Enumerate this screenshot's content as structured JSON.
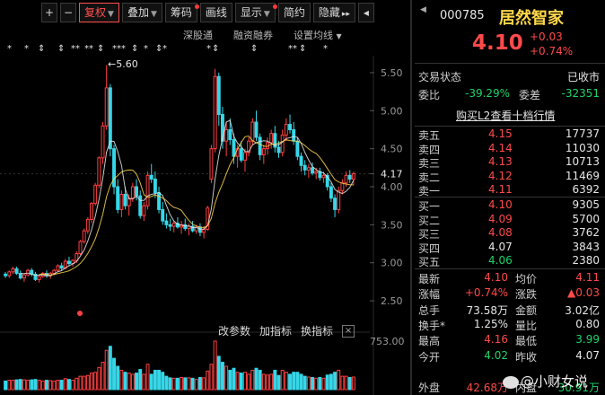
{
  "toolbar": {
    "plus": "+",
    "minus": "−",
    "fuquan": "复权",
    "diejia": "叠加",
    "chouma": "筹码",
    "huaxian": "画线",
    "xianshi": "显示",
    "jianyue": "简约",
    "yincang": "隐藏",
    "forward": "▸▸",
    "back": "◂"
  },
  "subbar": {
    "shenguting": "深股通",
    "rongzi": "融资融券",
    "junxian": "设置均线"
  },
  "markers": [
    "*",
    "*",
    "⇕",
    "⇕",
    "**",
    "**",
    "⇕",
    "***",
    "⇕",
    "*",
    "⇕",
    "*",
    "*",
    "⇕",
    "⇕",
    "**",
    "⇕",
    "*"
  ],
  "chart_data": {
    "type": "candlestick",
    "title": "",
    "y_ticks": [
      "5.50",
      "5.00",
      "4.50",
      "4.17",
      "4.00",
      "3.50",
      "3.00",
      "2.50"
    ],
    "ylim": [
      2.3,
      5.7
    ],
    "current_price": 4.17,
    "high_annotation": "5.60",
    "volume_tick": "753.00",
    "candles": [
      [
        2.85,
        2.88,
        2.8,
        2.83
      ],
      [
        2.83,
        2.9,
        2.8,
        2.88
      ],
      [
        2.88,
        2.95,
        2.85,
        2.92
      ],
      [
        2.92,
        2.95,
        2.84,
        2.86
      ],
      [
        2.86,
        2.9,
        2.78,
        2.8
      ],
      [
        2.8,
        2.86,
        2.75,
        2.84
      ],
      [
        2.84,
        2.92,
        2.82,
        2.9
      ],
      [
        2.9,
        2.93,
        2.82,
        2.85
      ],
      [
        2.85,
        2.88,
        2.76,
        2.78
      ],
      [
        2.78,
        2.84,
        2.74,
        2.82
      ],
      [
        2.82,
        2.88,
        2.8,
        2.86
      ],
      [
        2.86,
        2.9,
        2.8,
        2.83
      ],
      [
        2.83,
        2.88,
        2.79,
        2.86
      ],
      [
        2.86,
        2.92,
        2.84,
        2.9
      ],
      [
        2.9,
        2.98,
        2.88,
        2.96
      ],
      [
        2.96,
        3.0,
        2.9,
        2.93
      ],
      [
        2.93,
        3.05,
        2.91,
        3.02
      ],
      [
        3.02,
        3.08,
        2.96,
        2.99
      ],
      [
        2.99,
        3.05,
        2.95,
        3.03
      ],
      [
        3.03,
        3.15,
        3.0,
        3.12
      ],
      [
        3.12,
        3.3,
        3.1,
        3.28
      ],
      [
        3.28,
        3.45,
        3.25,
        3.42
      ],
      [
        3.42,
        3.6,
        3.38,
        3.57
      ],
      [
        3.57,
        3.8,
        3.52,
        3.78
      ],
      [
        3.78,
        4.05,
        3.75,
        4.02
      ],
      [
        4.02,
        4.4,
        3.98,
        4.38
      ],
      [
        4.38,
        4.85,
        4.3,
        4.8
      ],
      [
        4.8,
        5.6,
        4.75,
        5.3
      ],
      [
        5.3,
        5.35,
        4.4,
        4.5
      ],
      [
        4.5,
        4.55,
        3.9,
        4.0
      ],
      [
        4.0,
        4.1,
        3.65,
        3.7
      ],
      [
        3.7,
        3.95,
        3.6,
        3.9
      ],
      [
        3.9,
        4.0,
        3.7,
        3.75
      ],
      [
        3.75,
        3.9,
        3.62,
        3.85
      ],
      [
        3.85,
        4.05,
        3.8,
        4.0
      ],
      [
        4.0,
        4.1,
        3.82,
        3.88
      ],
      [
        3.88,
        3.95,
        3.58,
        3.62
      ],
      [
        3.62,
        3.8,
        3.55,
        3.75
      ],
      [
        3.75,
        4.2,
        3.7,
        4.15
      ],
      [
        4.15,
        4.3,
        4.05,
        4.1
      ],
      [
        4.1,
        4.2,
        3.85,
        3.92
      ],
      [
        3.92,
        4.0,
        3.65,
        3.7
      ],
      [
        3.7,
        3.8,
        3.5,
        3.55
      ],
      [
        3.55,
        3.65,
        3.45,
        3.5
      ],
      [
        3.5,
        3.58,
        3.42,
        3.48
      ],
      [
        3.48,
        3.55,
        3.4,
        3.52
      ],
      [
        3.52,
        3.6,
        3.45,
        3.47
      ],
      [
        3.47,
        3.55,
        3.38,
        3.5
      ],
      [
        3.5,
        3.58,
        3.42,
        3.45
      ],
      [
        3.45,
        3.52,
        3.36,
        3.48
      ],
      [
        3.48,
        3.55,
        3.4,
        3.42
      ],
      [
        3.42,
        3.5,
        3.38,
        3.47
      ],
      [
        3.47,
        3.52,
        3.35,
        3.4
      ],
      [
        3.4,
        3.48,
        3.32,
        3.44
      ],
      [
        3.44,
        3.75,
        3.42,
        3.72
      ],
      [
        4.1,
        4.55,
        4.05,
        4.5
      ],
      [
        4.5,
        5.55,
        4.45,
        5.45
      ],
      [
        5.45,
        5.5,
        4.8,
        4.95
      ],
      [
        4.95,
        5.05,
        4.5,
        4.6
      ],
      [
        4.6,
        4.85,
        4.4,
        4.75
      ],
      [
        4.75,
        4.9,
        4.55,
        4.62
      ],
      [
        4.62,
        4.7,
        4.3,
        4.4
      ],
      [
        4.4,
        4.55,
        4.25,
        4.5
      ],
      [
        4.5,
        4.6,
        4.32,
        4.35
      ],
      [
        4.35,
        4.5,
        4.2,
        4.45
      ],
      [
        4.45,
        4.65,
        4.4,
        4.6
      ],
      [
        4.6,
        4.9,
        4.55,
        4.85
      ],
      [
        4.85,
        5.0,
        4.6,
        4.65
      ],
      [
        4.65,
        4.7,
        4.35,
        4.42
      ],
      [
        4.42,
        4.55,
        4.3,
        4.5
      ],
      [
        4.5,
        4.65,
        4.42,
        4.58
      ],
      [
        4.58,
        4.75,
        4.5,
        4.7
      ],
      [
        4.7,
        4.8,
        4.45,
        4.52
      ],
      [
        4.52,
        4.6,
        4.38,
        4.45
      ],
      [
        4.45,
        4.75,
        4.4,
        4.68
      ],
      [
        4.68,
        4.9,
        4.6,
        4.82
      ],
      [
        4.82,
        4.95,
        4.7,
        4.75
      ],
      [
        4.75,
        4.85,
        4.55,
        4.6
      ],
      [
        4.6,
        4.65,
        4.35,
        4.4
      ],
      [
        4.4,
        4.45,
        4.2,
        4.28
      ],
      [
        4.28,
        4.35,
        4.15,
        4.22
      ],
      [
        4.22,
        4.3,
        4.12,
        4.25
      ],
      [
        4.25,
        4.32,
        4.15,
        4.18
      ],
      [
        4.18,
        4.25,
        4.1,
        4.2
      ],
      [
        4.2,
        4.25,
        4.08,
        4.12
      ],
      [
        4.12,
        4.2,
        4.05,
        4.15
      ],
      [
        4.15,
        4.18,
        3.95,
        4.0
      ],
      [
        4.0,
        4.05,
        3.8,
        3.85
      ],
      [
        3.85,
        3.9,
        3.6,
        3.7
      ],
      [
        3.7,
        4.0,
        3.65,
        3.95
      ],
      [
        3.95,
        4.1,
        3.9,
        4.05
      ],
      [
        4.05,
        4.2,
        4.0,
        4.15
      ],
      [
        4.15,
        4.22,
        4.05,
        4.1
      ],
      [
        4.1,
        4.2,
        4.02,
        4.17
      ]
    ]
  },
  "panel": {
    "code": "000785",
    "name": "居然智家",
    "price": "4.10",
    "change": "+0.03",
    "change_pct": "+0.74%",
    "trade_status_label": "交易状态",
    "trade_status": "已收市",
    "weibi_label": "委比",
    "weibi": "-39.29%",
    "weicha_label": "委差",
    "weicha": "-32351",
    "l2_link": "购买L2查看十档行情",
    "asks": [
      {
        "label": "卖五",
        "price": "4.15",
        "vol": "17737"
      },
      {
        "label": "卖四",
        "price": "4.14",
        "vol": "11030"
      },
      {
        "label": "卖三",
        "price": "4.13",
        "vol": "10713"
      },
      {
        "label": "卖二",
        "price": "4.12",
        "vol": "11469"
      },
      {
        "label": "卖一",
        "price": "4.11",
        "vol": "6392"
      }
    ],
    "bids": [
      {
        "label": "买一",
        "price": "4.10",
        "vol": "9305"
      },
      {
        "label": "买二",
        "price": "4.09",
        "vol": "5700"
      },
      {
        "label": "买三",
        "price": "4.08",
        "vol": "3762"
      },
      {
        "label": "买四",
        "price": "4.07",
        "vol": "3843"
      },
      {
        "label": "买五",
        "price": "4.06",
        "vol": "2380"
      }
    ],
    "stats": [
      {
        "l1": "最新",
        "v1": "4.10",
        "c1": "red",
        "l2": "均价",
        "v2": "4.11",
        "c2": "red"
      },
      {
        "l1": "涨幅",
        "v1": "+0.74%",
        "c1": "red",
        "l2": "涨跌",
        "v2": "▲0.03",
        "c2": "red"
      },
      {
        "l1": "总手",
        "v1": "73.58万",
        "c1": "white",
        "l2": "金额",
        "v2": "3.02亿",
        "c2": "white"
      },
      {
        "l1": "换手*",
        "v1": "1.25%",
        "c1": "white",
        "l2": "量比",
        "v2": "0.80",
        "c2": "white"
      },
      {
        "l1": "最高",
        "v1": "4.16",
        "c1": "red",
        "l2": "最低",
        "v2": "3.99",
        "c2": "green"
      },
      {
        "l1": "今开",
        "v1": "4.02",
        "c1": "green",
        "l2": "昨收",
        "v2": "4.07",
        "c2": "white"
      },
      {
        "l1": "",
        "v1": "",
        "c1": "white",
        "l2": "",
        "v2": "",
        "c2": "white"
      },
      {
        "l1": "外盘",
        "v1": "42.68万",
        "c1": "red",
        "l2": "内盘",
        "v2": "30.91万",
        "c2": "green"
      }
    ]
  },
  "indicators": {
    "gaicanshu": "改参数",
    "jiazhibiao": "加指标",
    "huanzhibiao": "换指标",
    "close": "×"
  },
  "watermark": "@小财女说"
}
